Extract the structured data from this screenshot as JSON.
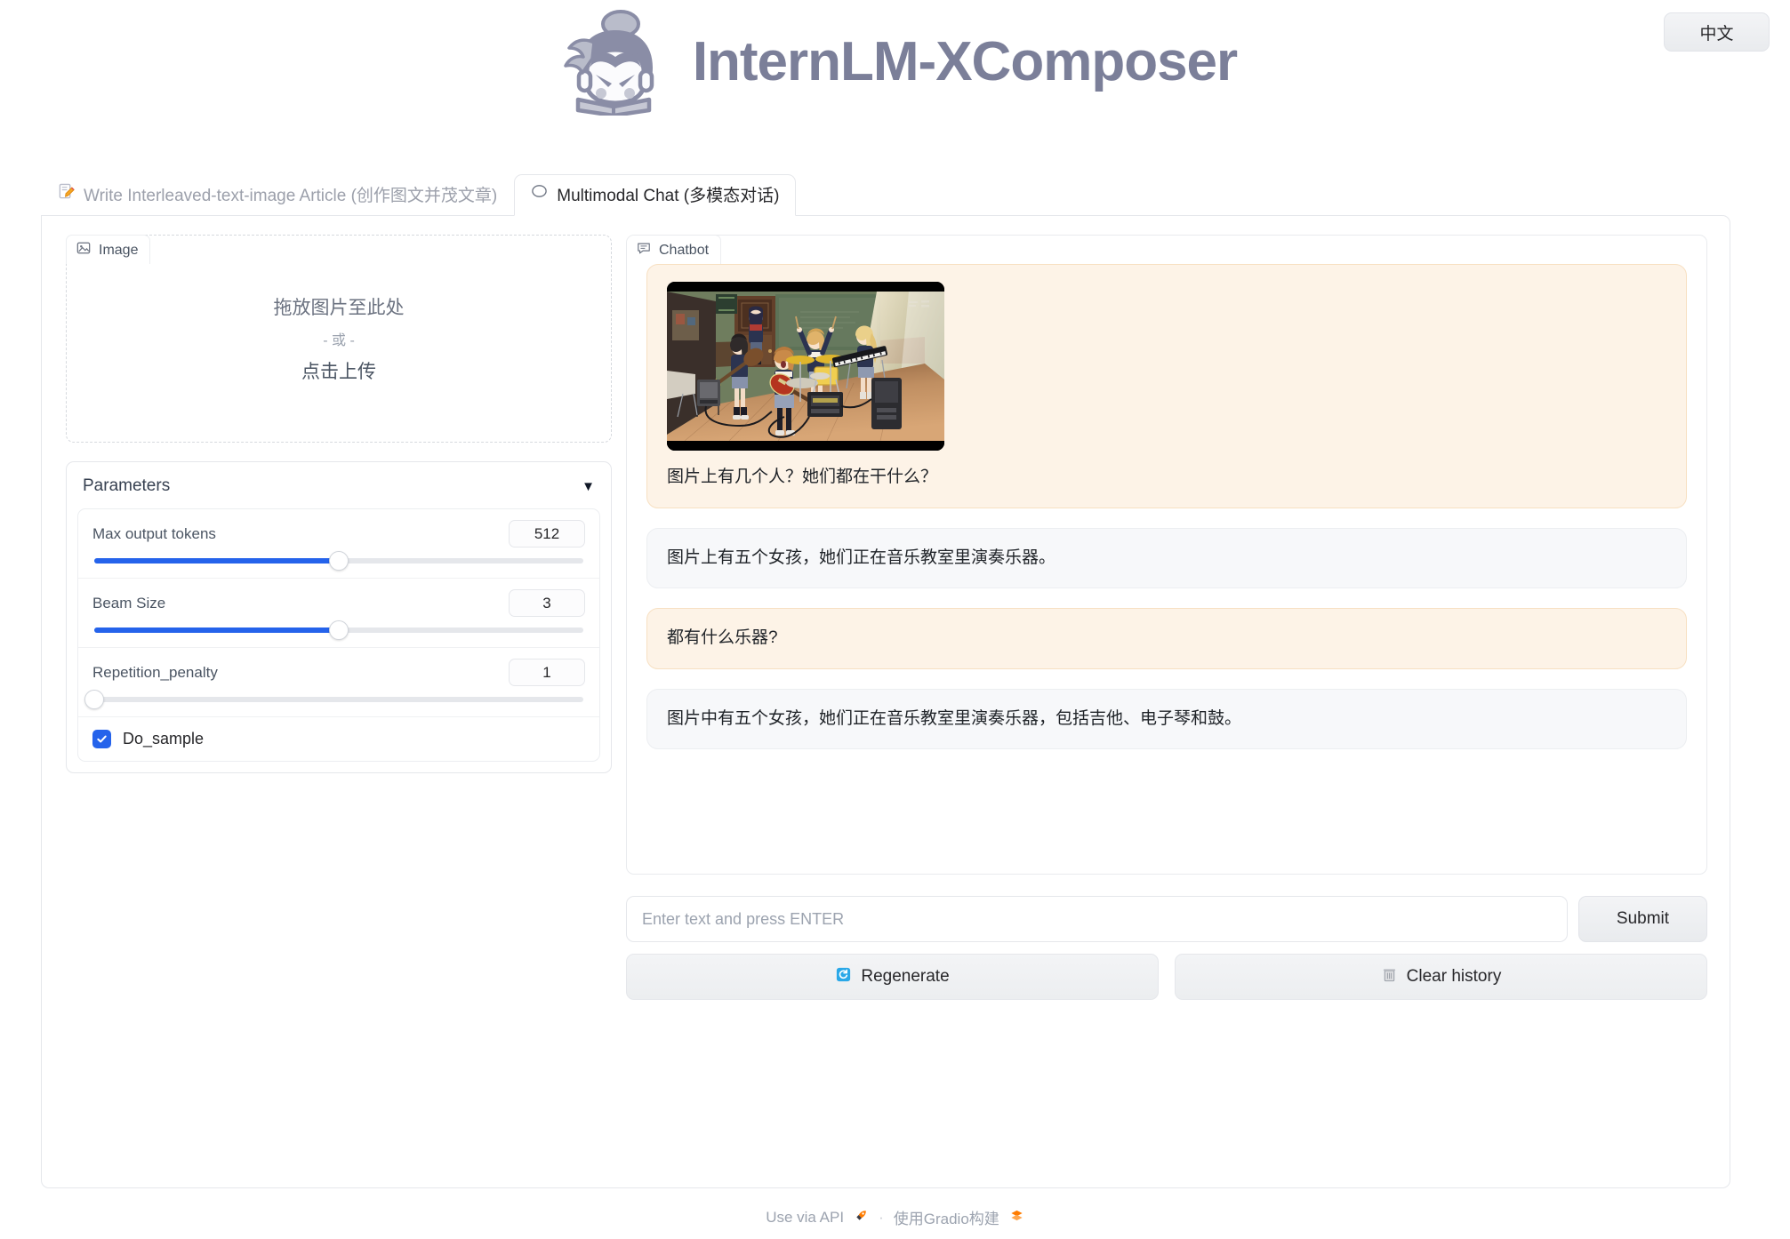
{
  "header": {
    "title": "InternLM-XComposer",
    "logo_icon": "intern-monk-logo-icon",
    "lang_button": "中文"
  },
  "tabs": [
    {
      "label": "Write Interleaved-text-image Article (创作图文并茂文章)",
      "icon": "memo-pencil-icon",
      "active": false
    },
    {
      "label": "Multimodal Chat (多模态对话)",
      "icon": "chat-bubble-icon",
      "active": true
    }
  ],
  "left": {
    "image_block": {
      "label": "Image",
      "icon": "image-placeholder-icon",
      "drop_primary": "拖放图片至此处",
      "drop_or": "- 或 -",
      "drop_click": "点击上传"
    },
    "parameters": {
      "title": "Parameters",
      "caret_icon": "chevron-down-icon",
      "sliders": [
        {
          "label": "Max output tokens",
          "value": "512",
          "fill_percent": 50
        },
        {
          "label": "Beam Size",
          "value": "3",
          "fill_percent": 50
        },
        {
          "label": "Repetition_penalty",
          "value": "1",
          "fill_percent": 0
        }
      ],
      "checkbox": {
        "label": "Do_sample",
        "checked": true
      }
    }
  },
  "right": {
    "chatbot_label": "Chatbot",
    "chatbot_icon": "chat-panel-icon",
    "messages": [
      {
        "role": "user",
        "has_image": true,
        "image_alt": "anime-band-classroom-photo",
        "text": "图片上有几个人？她们都在干什么？"
      },
      {
        "role": "bot",
        "has_image": false,
        "text": "图片上有五个女孩，她们正在音乐教室里演奏乐器。"
      },
      {
        "role": "user",
        "has_image": false,
        "text": "都有什么乐器?"
      },
      {
        "role": "bot",
        "has_image": false,
        "text": "图片中有五个女孩，她们正在音乐教室里演奏乐器，包括吉他、电子琴和鼓。"
      }
    ],
    "input_placeholder": "Enter text and press ENTER",
    "input_value": "",
    "submit_label": "Submit",
    "actions": [
      {
        "label": "Regenerate",
        "icon": "refresh-icon"
      },
      {
        "label": "Clear history",
        "icon": "trash-icon"
      }
    ]
  },
  "footer": {
    "api_label": "Use via API",
    "api_icon": "rocket-icon",
    "separator": "·",
    "gradio_label": "使用Gradio构建",
    "gradio_icon": "gradio-logo-icon"
  },
  "colors": {
    "accent_blue": "#2563eb",
    "title_gray": "#7b7f99",
    "user_bubble": "#fdf3e7",
    "bot_bubble": "#f7f8fa",
    "gradio_orange": "#ff7c00"
  }
}
